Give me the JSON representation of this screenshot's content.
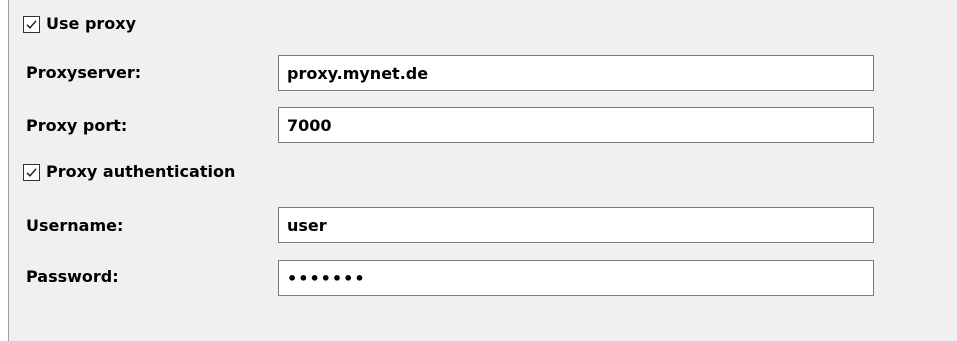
{
  "use_proxy": {
    "label": "Use proxy",
    "checked": true
  },
  "proxy_server": {
    "label": "Proxyserver:",
    "value": "proxy.mynet.de"
  },
  "proxy_port": {
    "label": "Proxy port:",
    "value": "7000"
  },
  "proxy_auth": {
    "label": "Proxy authentication",
    "checked": true
  },
  "username": {
    "label": "Username:",
    "value": "user"
  },
  "password": {
    "label": "Password:",
    "value": "•••••••"
  }
}
